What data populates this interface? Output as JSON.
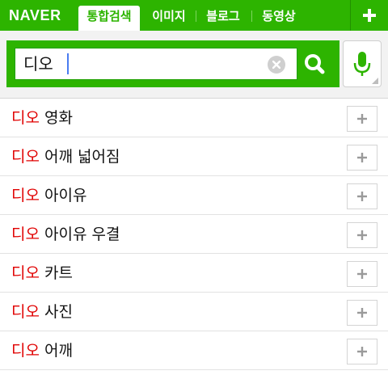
{
  "header": {
    "logo": "NAVER",
    "tabs": [
      {
        "label": "통합검색",
        "active": true
      },
      {
        "label": "이미지",
        "active": false
      },
      {
        "label": "블로그",
        "active": false
      },
      {
        "label": "동영상",
        "active": false
      }
    ],
    "add_icon": "plus-icon"
  },
  "search": {
    "query": "디오",
    "clear_icon": "close-icon",
    "search_icon": "search-icon",
    "voice_icon": "microphone-icon"
  },
  "suggestions": [
    {
      "keyword": "디오",
      "rest": " 영화",
      "add_icon": "plus-icon"
    },
    {
      "keyword": "디오",
      "rest": " 어깨 넓어짐",
      "add_icon": "plus-icon"
    },
    {
      "keyword": "디오",
      "rest": " 아이유",
      "add_icon": "plus-icon"
    },
    {
      "keyword": "디오",
      "rest": " 아이유 우결",
      "add_icon": "plus-icon"
    },
    {
      "keyword": "디오",
      "rest": " 카트",
      "add_icon": "plus-icon"
    },
    {
      "keyword": "디오",
      "rest": " 사진",
      "add_icon": "plus-icon"
    },
    {
      "keyword": "디오",
      "rest": " 어깨",
      "add_icon": "plus-icon"
    }
  ],
  "colors": {
    "brand": "#2db400",
    "highlight": "#e00000"
  }
}
